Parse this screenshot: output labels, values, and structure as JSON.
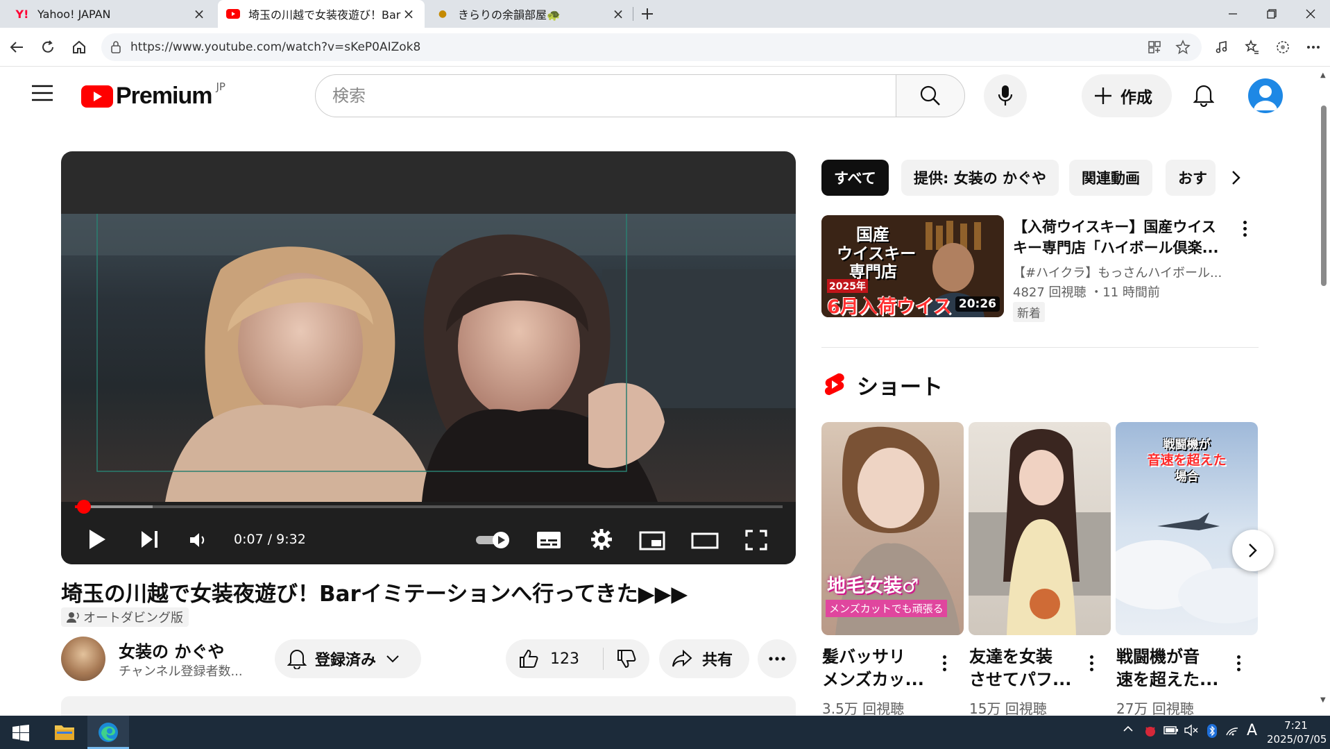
{
  "browser": {
    "tabs": [
      {
        "title": "Yahoo! JAPAN",
        "icon": "yahoo-icon",
        "active": false
      },
      {
        "title": "埼玉の川越で女装夜遊び！Barイミ",
        "icon": "youtube-icon",
        "active": true
      },
      {
        "title": "きらりの余韻部屋🐢",
        "icon": "emoji-icon",
        "active": false
      }
    ],
    "url": "https://www.youtube.com/watch?v=sKeP0AIZok8"
  },
  "youtube": {
    "logo_text": "Premium",
    "region": "JP",
    "search_placeholder": "検索",
    "create_label": "作成"
  },
  "player": {
    "time": "0:07 / 9:32",
    "progress_fraction": 0.013,
    "buffered_fraction": 0.11
  },
  "video": {
    "title": "埼玉の川越で女装夜遊び！Barイミテーションへ行ってきた▶▶▶",
    "dub_badge": "オートダビング版",
    "channel_name": "女装の かぐや",
    "channel_subs": "チャンネル登録者数...",
    "subscribed_label": "登録済み",
    "like_count": "123",
    "share_label": "共有"
  },
  "sidebar": {
    "chips": [
      "すべて",
      "提供: 女装の かぐや",
      "関連動画",
      "おす"
    ],
    "recommended": {
      "title_line1": "【入荷ウイスキー】国産ウイス",
      "title_line2": "キー専門店「ハイボール倶楽...",
      "channel": "【#ハイクラ】もっさんハイボール...",
      "meta": "4827 回視聴 ・11 時間前",
      "badge": "新着",
      "duration": "20:26",
      "thumb_text1": "国産",
      "thumb_text2": "ウイスキー",
      "thumb_text3": "専門店",
      "thumb_year": "2025年",
      "thumb_banner": "6月入荷ウイス"
    },
    "shorts_heading": "ショート",
    "shorts": [
      {
        "line1": "髪バッサリ",
        "line2": "メンズカッ...",
        "views": "3.5万 回視聴",
        "overlay1": "地毛女装♂",
        "overlay2": "メンズカットでも頑張る"
      },
      {
        "line1": "友達を女装",
        "line2": "させてパフ...",
        "views": "15万 回視聴"
      },
      {
        "line1": "戦闘機が音",
        "line2": "速を超えた...",
        "views": "27万 回視聴",
        "overlay1": "戦闘機が",
        "overlay2": "音速を超えた",
        "overlay3": "場合"
      }
    ]
  },
  "taskbar": {
    "time": "7:21",
    "date": "2025/07/05",
    "ime": "A"
  },
  "colors": {
    "youtube_red": "#ff0000",
    "chip_active": "#0f0f0f",
    "avatar_blue": "#1e88e5",
    "taskbar": "#1c2b3a"
  }
}
